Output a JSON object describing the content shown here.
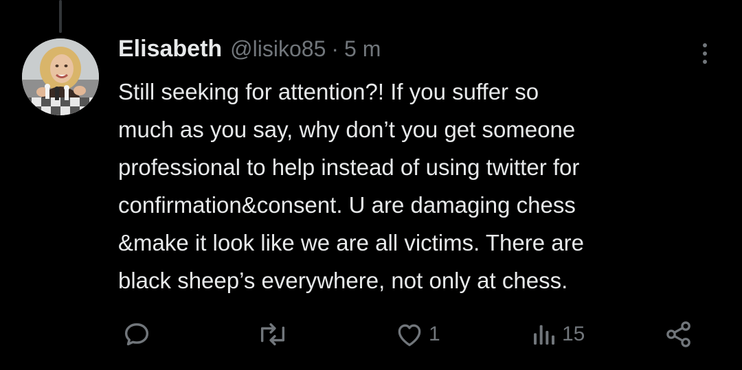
{
  "tweet": {
    "author_name": "Elisabeth",
    "handle": "@lisiko85",
    "separator": "·",
    "time": "5 m",
    "text": "Still seeking for attention?! If you suffer so\nmuch as you say, why don’t you get someone\nprofessional to help instead of using twitter for\nconfirmation&consent. U are damaging chess\n&make it look like we are all victims. There are\nblack sheep’s everywhere, not only at chess."
  },
  "actions": {
    "reply": {
      "icon": "reply-icon",
      "count": ""
    },
    "retweet": {
      "icon": "retweet-icon",
      "count": ""
    },
    "like": {
      "icon": "heart-icon",
      "count": "1"
    },
    "views": {
      "icon": "analytics-icon",
      "count": "15"
    },
    "share": {
      "icon": "share-icon",
      "count": ""
    }
  },
  "colors": {
    "background": "#000000",
    "text_primary": "#e7e9ea",
    "text_secondary": "#71767b",
    "thread_line": "#333639"
  }
}
